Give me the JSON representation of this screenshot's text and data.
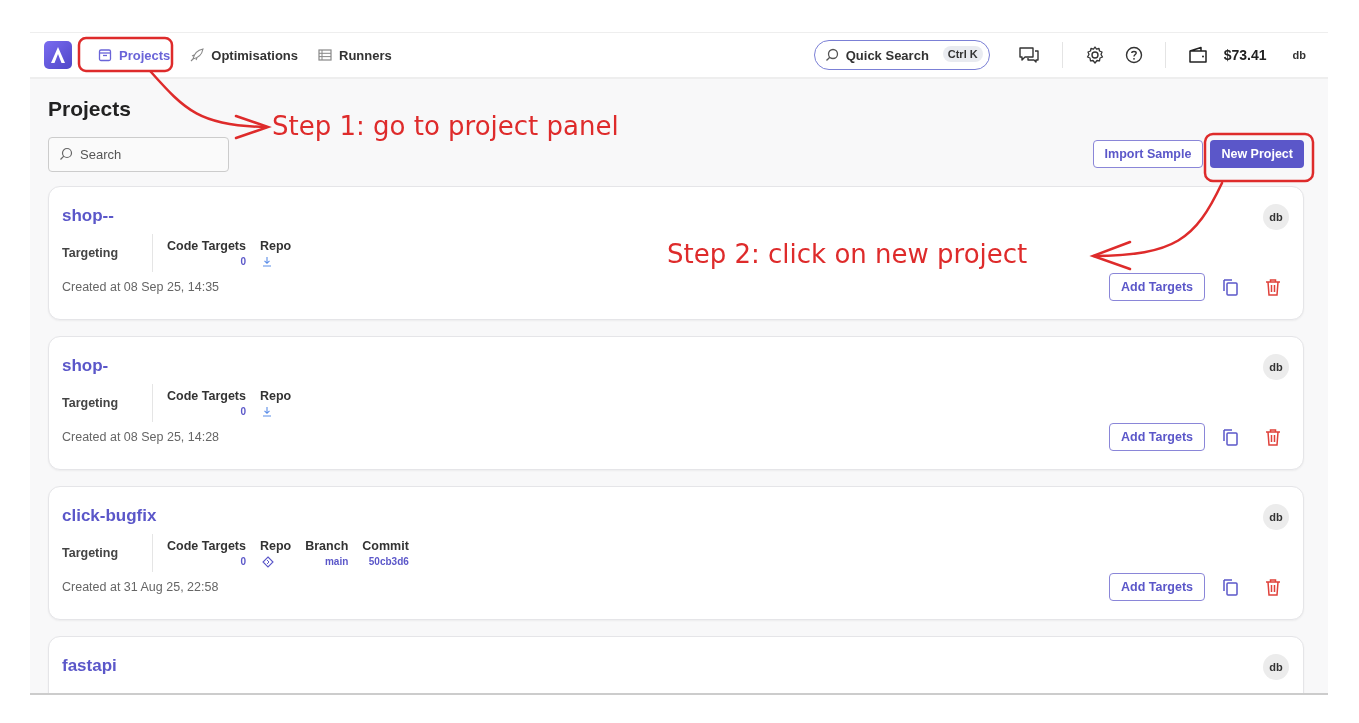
{
  "nav": {
    "tabs": [
      {
        "label": "Projects",
        "selected": true
      },
      {
        "label": "Optimisations",
        "selected": false
      },
      {
        "label": "Runners",
        "selected": false
      }
    ],
    "quick_search": {
      "placeholder": "Quick Search",
      "shortcut": "Ctrl K"
    },
    "balance": "$73.41",
    "user": "db"
  },
  "page": {
    "title": "Projects",
    "search": {
      "placeholder": "Search"
    },
    "buttons": {
      "import": "Import Sample",
      "new": "New Project"
    }
  },
  "projects": [
    {
      "name": "shop--",
      "owner": "db",
      "targeting": "Targeting",
      "fields": [
        {
          "label": "Code Targets",
          "value": "0",
          "kind": "text"
        },
        {
          "label": "Repo",
          "kind": "pending"
        }
      ],
      "created": "Created at 08 Sep 25, 14:35",
      "action": "Add Targets"
    },
    {
      "name": "shop-",
      "owner": "db",
      "targeting": "Targeting",
      "fields": [
        {
          "label": "Code Targets",
          "value": "0",
          "kind": "text"
        },
        {
          "label": "Repo",
          "kind": "pending"
        }
      ],
      "created": "Created at 08 Sep 25, 14:28",
      "action": "Add Targets"
    },
    {
      "name": "click-bugfix",
      "owner": "db",
      "targeting": "Targeting",
      "fields": [
        {
          "label": "Code Targets",
          "value": "0",
          "kind": "text"
        },
        {
          "label": "Repo",
          "kind": "git"
        },
        {
          "label": "Branch",
          "value": "main",
          "kind": "text"
        },
        {
          "label": "Commit",
          "value": "50cb3d6",
          "kind": "text"
        }
      ],
      "created": "Created at 31 Aug 25, 22:58",
      "action": "Add Targets"
    },
    {
      "name": "fastapi",
      "owner": "db"
    }
  ],
  "annotations": [
    {
      "text": "Step 1: go to project panel"
    },
    {
      "text": "Step 2: click on new project"
    }
  ]
}
